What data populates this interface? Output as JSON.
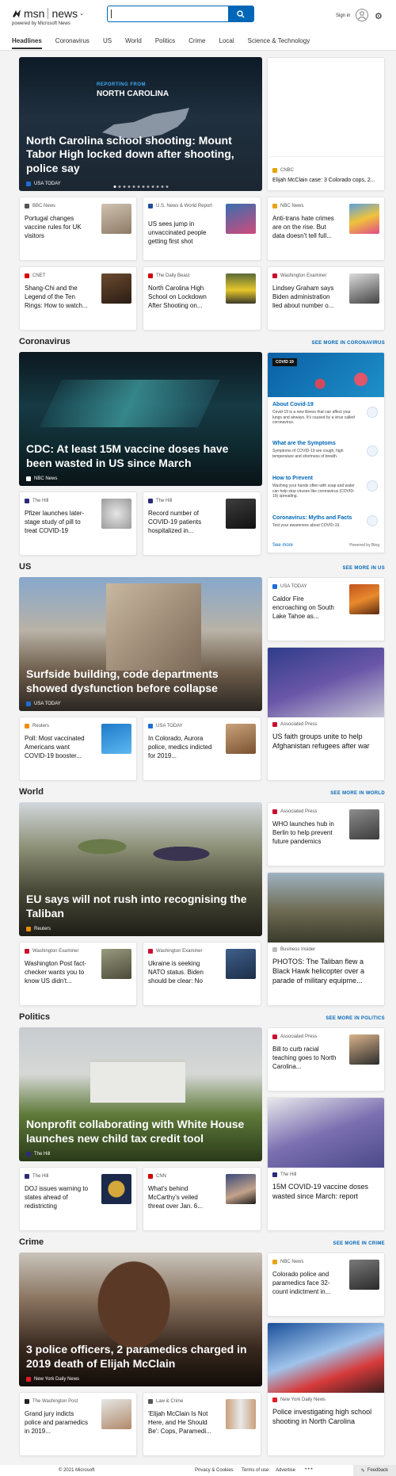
{
  "brand": {
    "msn": "msn",
    "news": "news",
    "powered": "powered by Microsoft News"
  },
  "search": {
    "placeholder": ""
  },
  "header": {
    "signin": "Sign in"
  },
  "nav": [
    "Headlines",
    "Coronavirus",
    "US",
    "World",
    "Politics",
    "Crime",
    "Local",
    "Science & Technology"
  ],
  "top": {
    "hero": {
      "kicker": "REPORTING FROM",
      "state": "NORTH CAROLINA",
      "title": "North Carolina school shooting: Mount Tabor High locked down after shooting, police say",
      "source": "USA TODAY"
    },
    "side": {
      "source": "CNBC",
      "title": "Elijah McClain case: 3 Colorado cops, 2..."
    },
    "row1": [
      {
        "source": "BBC News",
        "title": "Portugal changes vaccine rules for UK visitors"
      },
      {
        "source": "U.S. News & World Report",
        "title": "US sees jump in unvaccinated people getting first shot"
      },
      {
        "source": "NBC News",
        "title": "Anti-trans hate crimes are on the rise. But data doesn't tell full..."
      }
    ],
    "row2": [
      {
        "source": "CNET",
        "title": "Shang-Chi and the Legend of the Ten Rings: How to watch..."
      },
      {
        "source": "The Daily Beast",
        "title": "North Carolina High School on Lockdown After Shooting on..."
      },
      {
        "source": "Washington Examiner",
        "title": "Lindsey Graham says Biden administration lied about number o..."
      }
    ]
  },
  "coronavirus": {
    "section": "Coronavirus",
    "see_more": "SEE MORE IN CORONAVIRUS",
    "hero": {
      "title": "CDC: At least 15M vaccine doses have been wasted in US since March",
      "source": "NBC News"
    },
    "panel": {
      "badge": "COVID 19",
      "items": [
        {
          "h": "About Covid-19",
          "p": "Covid-19 is a new illness that can affect your lungs and airways. It's caused by a virus called coronavirus."
        },
        {
          "h": "What are the Symptoms",
          "p": "Symptoms of COVID-19 are cough, high temperature and shortness of breath."
        },
        {
          "h": "How to Prevent",
          "p": "Washing your hands often with soap and water can help stop viruses like coronavirus (COVID-19) spreading."
        },
        {
          "h": "Coronavirus: Myths and Facts",
          "p": "Test your awareness about COVID-19."
        }
      ],
      "see_more": "See more",
      "powered": "Powered by Bing"
    },
    "row": [
      {
        "source": "The Hill",
        "title": "Pfizer launches later-stage study of pill to treat COVID-19"
      },
      {
        "source": "The Hill",
        "title": "Record number of COVID-19 patients hospitalized in..."
      }
    ]
  },
  "us": {
    "section": "US",
    "see_more": "SEE MORE IN US",
    "hero": {
      "title": "Surfside building, code departments showed dysfunction before collapse",
      "source": "USA TODAY"
    },
    "side_small": {
      "source": "USA TODAY",
      "title": "Caldor Fire encroaching on South Lake Tahoe as..."
    },
    "side_big": {
      "source": "Associated Press",
      "title": "US faith groups unite to help Afghanistan refugees after war"
    },
    "row": [
      {
        "source": "Reuters",
        "title": "Poll: Most vaccinated Americans want COVID-19 booster..."
      },
      {
        "source": "USA TODAY",
        "title": "In Colorado, Aurora police, medics indicted for 2019..."
      }
    ]
  },
  "world": {
    "section": "World",
    "see_more": "SEE MORE IN WORLD",
    "hero": {
      "title": "EU says will not rush into recognising the Taliban",
      "source": "Reuters"
    },
    "side_small": {
      "source": "Associated Press",
      "title": "WHO launches hub in Berlin to help prevent future pandemics"
    },
    "side_big": {
      "source": "Business Insider",
      "title": "PHOTOS: The Taliban flew a Black Hawk helicopter over a parade of military equipme..."
    },
    "row": [
      {
        "source": "Washington Examiner",
        "title": "Washington Post fact-checker wants you to know US didn't..."
      },
      {
        "source": "Washington Examiner",
        "title": "Ukraine is seeking NATO status. Biden should be clear: No"
      }
    ]
  },
  "politics": {
    "section": "Politics",
    "see_more": "SEE MORE IN POLITICS",
    "hero": {
      "title": "Nonprofit collaborating with White House launches new child tax credit tool",
      "source": "The Hill"
    },
    "side_small": {
      "source": "Associated Press",
      "title": "Bill to curb racial teaching goes to North Carolina..."
    },
    "side_big": {
      "source": "The Hill",
      "title": "15M COVID-19 vaccine doses wasted since March: report"
    },
    "row": [
      {
        "source": "The Hill",
        "title": "DOJ issues warning to states ahead of redistricting"
      },
      {
        "source": "CNN",
        "title": "What's behind McCarthy's veiled threat over Jan. 6..."
      }
    ]
  },
  "crime": {
    "section": "Crime",
    "see_more": "SEE MORE IN CRIME",
    "hero": {
      "title": "3 police officers, 2 paramedics charged in 2019 death of Elijah McClain",
      "source": "New York Daily News"
    },
    "side_small": {
      "source": "NBC News",
      "title": "Colorado police and paramedics face 32-count indictment in..."
    },
    "side_big": {
      "source": "New York Daily News",
      "title": "Police investigating high school shooting in North Carolina"
    },
    "row": [
      {
        "source": "The Washington Post",
        "title": "Grand jury indicts police and paramedics in 2019..."
      },
      {
        "source": "Law & Crime",
        "title": "'Elijah McClain Is Not Here, and He Should Be': Cops, Paramedi..."
      }
    ]
  },
  "footer": {
    "copyright": "© 2021 Microsoft",
    "privacy": "Privacy & Cookies",
    "terms": "Terms of use",
    "advertise": "Advertise",
    "more": "• • •",
    "feedback": "Feedback"
  },
  "colors": {
    "accent": "#0067b8",
    "background": "#f3f3f3"
  }
}
